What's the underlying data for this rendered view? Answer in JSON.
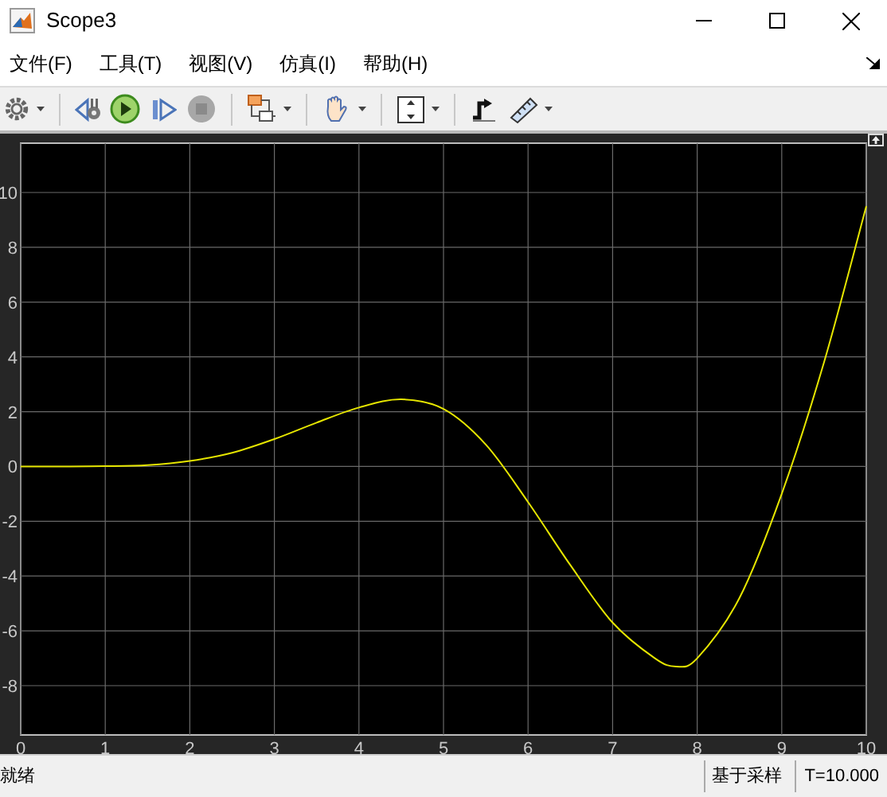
{
  "window": {
    "title": "Scope3"
  },
  "menu": [
    {
      "label": "文件(F)"
    },
    {
      "label": "工具(T)"
    },
    {
      "label": "视图(V)"
    },
    {
      "label": "仿真(I)"
    },
    {
      "label": "帮助(H)"
    }
  ],
  "scope": {
    "chart_data": {
      "type": "line",
      "x": [
        0,
        0.5,
        1,
        1.5,
        2,
        2.5,
        3,
        3.5,
        4,
        4.5,
        5,
        5.5,
        6,
        6.5,
        7,
        7.5,
        7.75,
        8,
        8.5,
        9,
        9.5,
        10
      ],
      "series": [
        {
          "color": "#e6e600",
          "values": [
            0,
            0,
            0.01,
            0.05,
            0.2,
            0.5,
            1.0,
            1.6,
            2.15,
            2.45,
            2.1,
            0.8,
            -1.3,
            -3.6,
            -5.7,
            -7.0,
            -7.3,
            -7.0,
            -4.8,
            -1.0,
            3.8,
            9.5
          ]
        }
      ],
      "xlim": [
        0,
        10
      ],
      "ylim": [
        -9.8,
        11.8
      ],
      "xticks": [
        0,
        1,
        2,
        3,
        4,
        5,
        6,
        7,
        8,
        9,
        10
      ],
      "yticks": [
        -8,
        -6,
        -4,
        -2,
        0,
        2,
        4,
        6,
        8,
        10
      ],
      "grid": true
    }
  },
  "status_bar": {
    "message": "就绪",
    "mode": "基于采样",
    "time": "T=10.000"
  }
}
